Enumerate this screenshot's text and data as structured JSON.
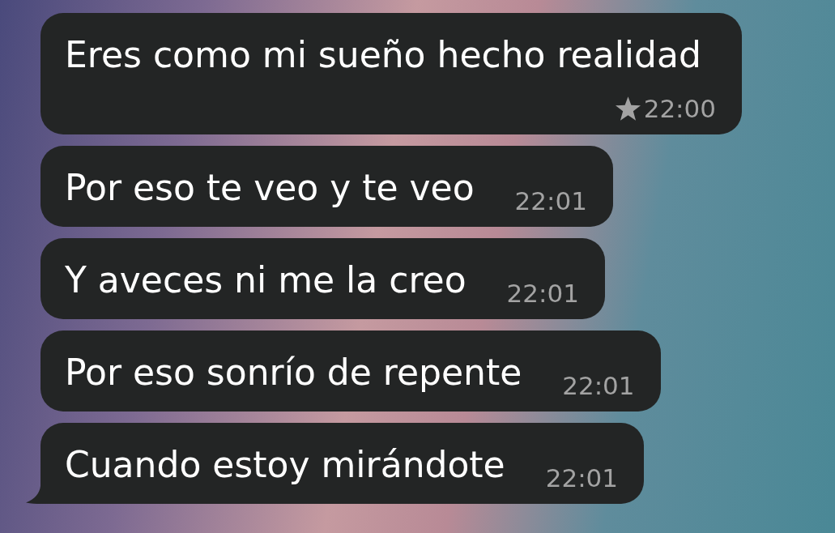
{
  "messages": [
    {
      "text": "Eres como mi sueño hecho realidad",
      "time": "22:00",
      "starred": true,
      "tail": false
    },
    {
      "text": "Por eso te veo y te veo",
      "time": "22:01",
      "starred": false,
      "tail": false
    },
    {
      "text": "Y aveces ni me la creo",
      "time": "22:01",
      "starred": false,
      "tail": false
    },
    {
      "text": "Por eso sonrío de repente",
      "time": "22:01",
      "starred": false,
      "tail": false
    },
    {
      "text": "Cuando estoy mirándote",
      "time": "22:01",
      "starred": false,
      "tail": true
    }
  ]
}
